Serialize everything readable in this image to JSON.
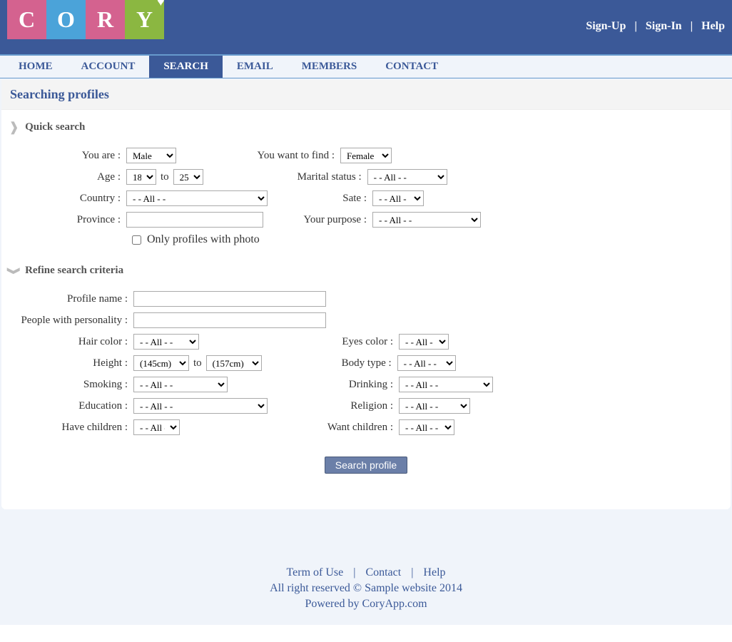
{
  "topLinks": {
    "signUp": "Sign-Up",
    "signIn": "Sign-In",
    "help": "Help"
  },
  "nav": {
    "home": "HOME",
    "account": "ACCOUNT",
    "search": "SEARCH",
    "email": "EMAIL",
    "members": "MEMBERS",
    "contact": "CONTACT"
  },
  "pageTitle": "Searching profiles",
  "quick": {
    "title": "Quick search",
    "youAre": {
      "label": "You are :",
      "value": "Male"
    },
    "wantFind": {
      "label": "You want to find :",
      "value": "Female"
    },
    "age": {
      "label": "Age :",
      "from": "18",
      "to": "25",
      "toText": "to"
    },
    "marital": {
      "label": "Marital status :",
      "value": "- - All - -"
    },
    "country": {
      "label": "Country :",
      "value": "- - All - -"
    },
    "state": {
      "label": "Sate :",
      "value": "- - All - -"
    },
    "province": {
      "label": "Province :",
      "value": ""
    },
    "purpose": {
      "label": "Your purpose :",
      "value": "- - All - -"
    },
    "onlyPhoto": "Only profiles with photo"
  },
  "refine": {
    "title": "Refine search criteria",
    "profileName": {
      "label": "Profile name :",
      "value": ""
    },
    "personality": {
      "label": "People with personality :",
      "value": ""
    },
    "hairColor": {
      "label": "Hair color :",
      "value": "- - All - -"
    },
    "eyesColor": {
      "label": "Eyes color :",
      "value": "- - All - -"
    },
    "height": {
      "label": "Height :",
      "from": "(145cm)",
      "to": "(157cm)",
      "toText": "to"
    },
    "bodyType": {
      "label": "Body type :",
      "value": "- - All - -"
    },
    "smoking": {
      "label": "Smoking :",
      "value": "- - All - -"
    },
    "drinking": {
      "label": "Drinking :",
      "value": "- - All - -"
    },
    "education": {
      "label": "Education :",
      "value": "- - All - -"
    },
    "religion": {
      "label": "Religion :",
      "value": "- - All - -"
    },
    "haveChildren": {
      "label": "Have children :",
      "value": "- - All - -"
    },
    "wantChildren": {
      "label": "Want children :",
      "value": "- - All - -"
    }
  },
  "button": "Search profile",
  "footer": {
    "terms": "Term of Use",
    "contact": "Contact",
    "help": "Help",
    "copyright": "All right reserved © Sample website 2014",
    "powered": "Powered by CoryApp.com"
  }
}
